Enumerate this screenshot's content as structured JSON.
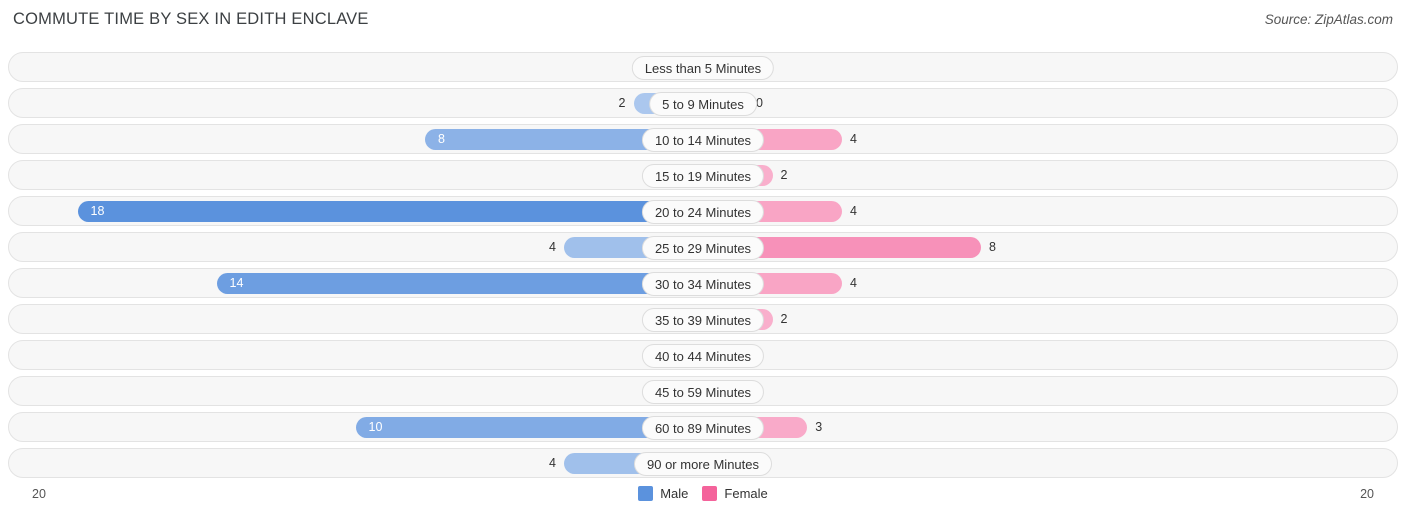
{
  "header": {
    "title": "COMMUTE TIME BY SEX IN EDITH ENCLAVE",
    "source": "Source: ZipAtlas.com"
  },
  "legend": {
    "items": [
      {
        "label": "Male",
        "color": "#5b92dd"
      },
      {
        "label": "Female",
        "color": "#f4639b"
      }
    ]
  },
  "axis": {
    "left_label": "20",
    "right_label": "20"
  },
  "chart_data": {
    "type": "bar",
    "orientation": "horizontal-diverging",
    "title": "COMMUTE TIME BY SEX IN EDITH ENCLAVE",
    "xlabel": "",
    "ylabel": "",
    "axis_max": 20,
    "grid": false,
    "legend_position": "bottom-center",
    "categories": [
      "Less than 5 Minutes",
      "5 to 9 Minutes",
      "10 to 14 Minutes",
      "15 to 19 Minutes",
      "20 to 24 Minutes",
      "25 to 29 Minutes",
      "30 to 34 Minutes",
      "35 to 39 Minutes",
      "40 to 44 Minutes",
      "45 to 59 Minutes",
      "60 to 89 Minutes",
      "90 or more Minutes"
    ],
    "series": [
      {
        "name": "Male",
        "color": "#5b92dd",
        "values": [
          0,
          2,
          8,
          0,
          18,
          4,
          14,
          0,
          0,
          0,
          10,
          4
        ]
      },
      {
        "name": "Female",
        "color": "#f4639b",
        "values": [
          0,
          0,
          4,
          2,
          4,
          8,
          4,
          2,
          0,
          0,
          3,
          0
        ]
      }
    ]
  }
}
